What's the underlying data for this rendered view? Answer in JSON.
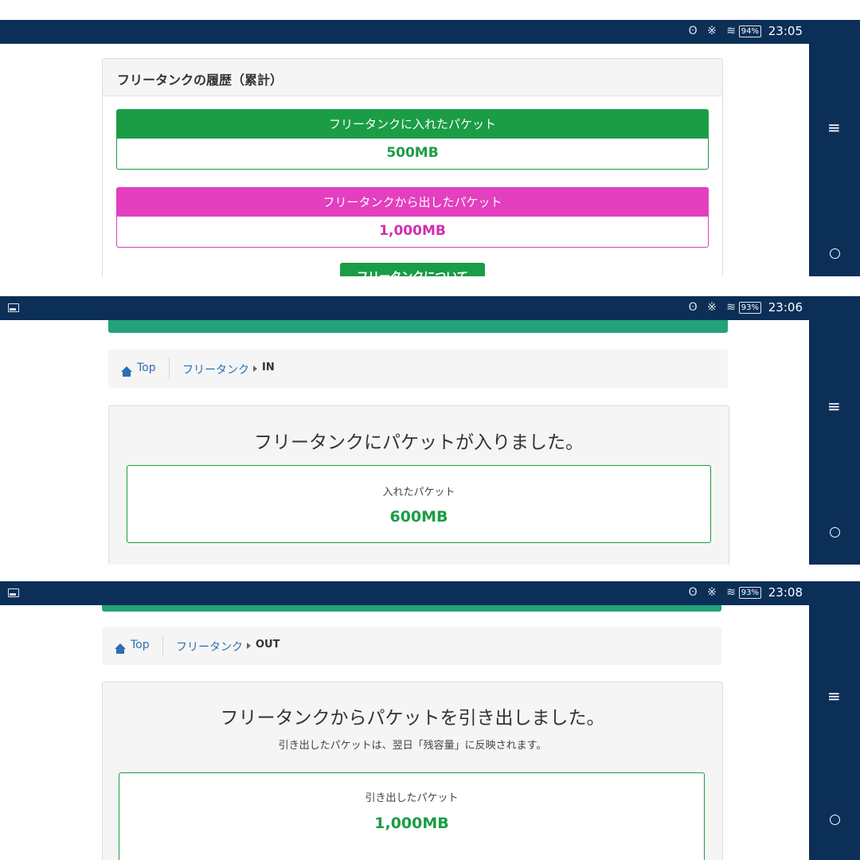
{
  "panel1": {
    "status": {
      "icons": "ʘ ※ ≋",
      "battery": "94%",
      "time": "23:05"
    },
    "card_title": "フリータンクの履歴（累計）",
    "stats": [
      {
        "label": "フリータンクに入れたパケット",
        "value": "500MB"
      },
      {
        "label": "フリータンクから出したパケット",
        "value": "1,000MB"
      }
    ],
    "about_button": "フリータンクについて"
  },
  "panel2": {
    "status": {
      "icons": "ʘ ※ ≋",
      "battery": "93%",
      "time": "23:06"
    },
    "breadcrumb": {
      "top": "Top",
      "section": "フリータンク",
      "current": "IN"
    },
    "heading": "フリータンクにパケットが入りました。",
    "box_label": "入れたパケット",
    "box_value": "600MB"
  },
  "panel3": {
    "status": {
      "icons": "ʘ ※ ≋",
      "battery": "93%",
      "time": "23:08"
    },
    "breadcrumb": {
      "top": "Top",
      "section": "フリータンク",
      "current": "OUT"
    },
    "heading": "フリータンクからパケットを引き出しました。",
    "note": "引き出したパケットは、翌日「残容量」に反映されます。",
    "box_label": "引き出したパケット",
    "box_value": "1,000MB"
  },
  "nav": {
    "menu_icon": "≡"
  },
  "colors": {
    "green": "#1a9d45",
    "pink": "#e33fbf",
    "navy": "#0c2f58",
    "teal": "#22a27b",
    "link": "#2d6eb5"
  }
}
